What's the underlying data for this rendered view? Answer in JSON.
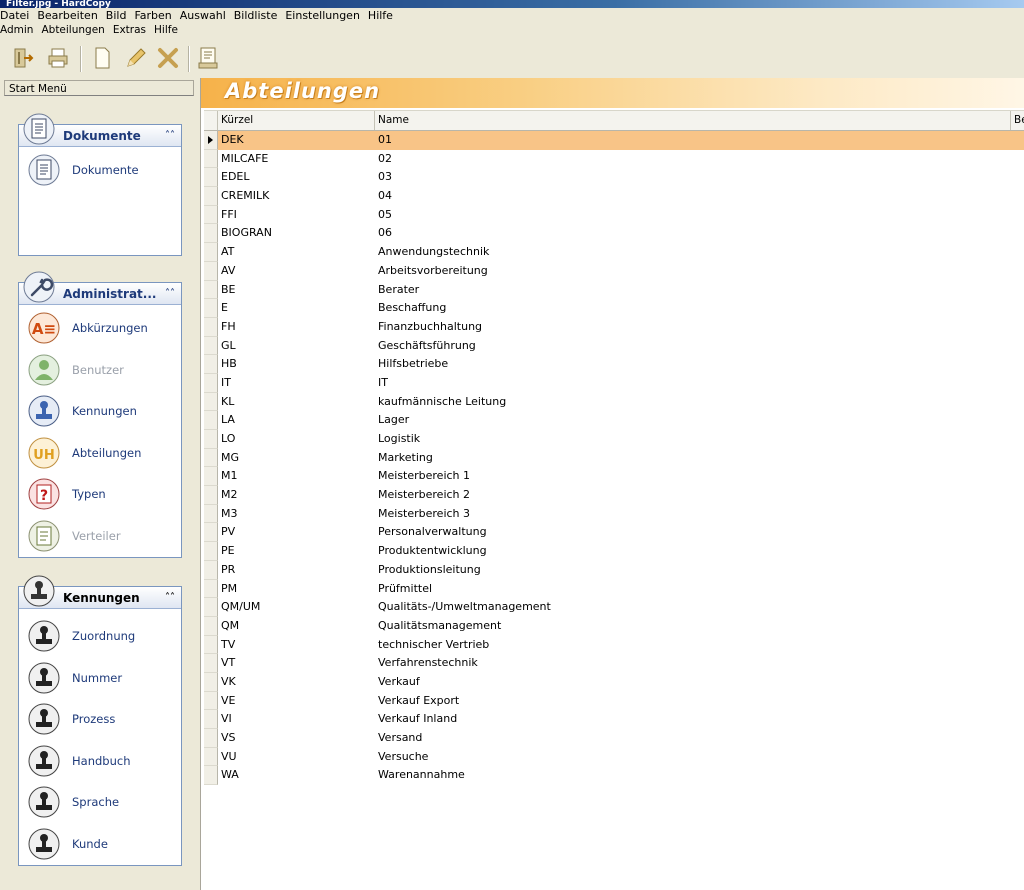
{
  "window": {
    "title": "Filter.jpg - HardCopy"
  },
  "menubar": {
    "row1": [
      "Datei",
      "Bearbeiten",
      "Bild",
      "Farben",
      "Auswahl",
      "Bildliste",
      "Einstellungen",
      "Hilfe"
    ],
    "row2": [
      "Admin",
      "Abteilungen",
      "Extras",
      "Hilfe"
    ]
  },
  "toolbar": {
    "icons": [
      "exit-icon",
      "printer-icon",
      "new-document-icon",
      "edit-pencil-icon",
      "delete-x-icon",
      "report-icon"
    ]
  },
  "sidebar": {
    "title": "Start Menü",
    "groups": [
      {
        "title": "Dokumente",
        "items": [
          {
            "label": "Dokumente",
            "enabled": true
          }
        ]
      },
      {
        "title": "Administrat...",
        "items": [
          {
            "label": "Abkürzungen",
            "enabled": true
          },
          {
            "label": "Benutzer",
            "enabled": false
          },
          {
            "label": "Kennungen",
            "enabled": true
          },
          {
            "label": "Abteilungen",
            "enabled": true
          },
          {
            "label": "Typen",
            "enabled": true
          },
          {
            "label": "Verteiler",
            "enabled": false
          }
        ]
      },
      {
        "title": "Kennungen",
        "items": [
          {
            "label": "Zuordnung",
            "enabled": true
          },
          {
            "label": "Nummer",
            "enabled": true
          },
          {
            "label": "Prozess",
            "enabled": true
          },
          {
            "label": "Handbuch",
            "enabled": true
          },
          {
            "label": "Sprache",
            "enabled": true
          },
          {
            "label": "Kunde",
            "enabled": true
          }
        ]
      }
    ]
  },
  "main": {
    "banner_title": "Abteilungen",
    "columns": [
      "Kürzel",
      "Name",
      "Be"
    ],
    "selected_row": 0,
    "rows": [
      [
        "DEK",
        "01"
      ],
      [
        "MILCAFE",
        "02"
      ],
      [
        "EDEL",
        "03"
      ],
      [
        "CREMILK",
        "04"
      ],
      [
        "FFI",
        "05"
      ],
      [
        "BIOGRAN",
        "06"
      ],
      [
        "AT",
        "Anwendungstechnik"
      ],
      [
        "AV",
        "Arbeitsvorbereitung"
      ],
      [
        "BE",
        "Berater"
      ],
      [
        "E",
        "Beschaffung"
      ],
      [
        "FH",
        "Finanzbuchhaltung"
      ],
      [
        "GL",
        "Geschäftsführung"
      ],
      [
        "HB",
        "Hilfsbetriebe"
      ],
      [
        "IT",
        "IT"
      ],
      [
        "KL",
        "kaufmännische Leitung"
      ],
      [
        "LA",
        "Lager"
      ],
      [
        "LO",
        "Logistik"
      ],
      [
        "MG",
        "Marketing"
      ],
      [
        "M1",
        "Meisterbereich 1"
      ],
      [
        "M2",
        "Meisterbereich 2"
      ],
      [
        "M3",
        "Meisterbereich 3"
      ],
      [
        "PV",
        "Personalverwaltung"
      ],
      [
        "PE",
        "Produktentwicklung"
      ],
      [
        "PR",
        "Produktionsleitung"
      ],
      [
        "PM",
        "Prüfmittel"
      ],
      [
        "QM/UM",
        "Qualitäts-/Umweltmanagement"
      ],
      [
        "QM",
        "Qualitätsmanagement"
      ],
      [
        "TV",
        "technischer Vertrieb"
      ],
      [
        "VT",
        "Verfahrenstechnik"
      ],
      [
        "VK",
        "Verkauf"
      ],
      [
        "VE",
        "Verkauf Export"
      ],
      [
        "VI",
        "Verkauf Inland"
      ],
      [
        "VS",
        "Versand"
      ],
      [
        "VU",
        "Versuche"
      ],
      [
        "WA",
        "Warenannahme"
      ]
    ]
  },
  "colors": {
    "banner_orange": "#f6b24a",
    "selected_row": "#f8c487",
    "group_text": "#1e3a7a",
    "chrome": "#ece9d8"
  }
}
